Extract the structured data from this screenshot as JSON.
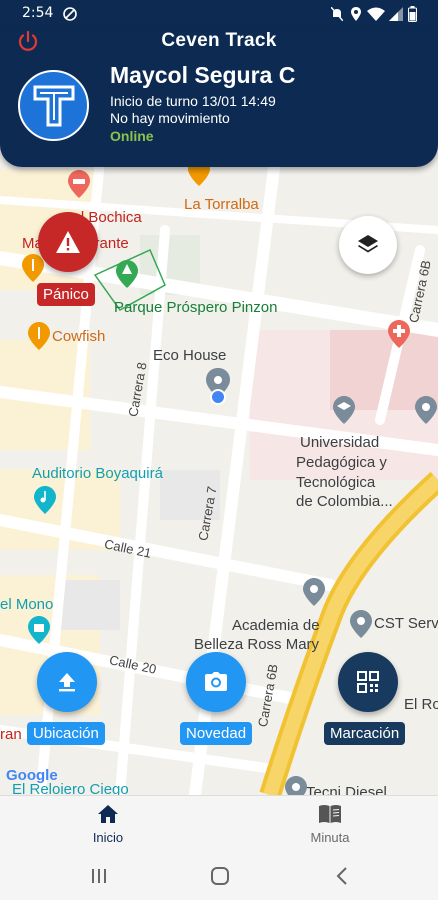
{
  "status_bar": {
    "time": "2:54"
  },
  "header": {
    "title": "Ceven Track",
    "user_name": "Maycol Segura C",
    "shift": "Inicio de turno 13/01 14:49",
    "movement": "No hay movimiento",
    "connection": "Online"
  },
  "map": {
    "places": {
      "hotel": "otel Bochica",
      "restaurant": "Ma    Restaurante",
      "torralba": "La Torralba",
      "park": "Parque Próspero Pinzon",
      "cowfish": "Cowfish",
      "eco_house": "Eco House",
      "university_1": "Universidad",
      "university_2": "Pedagógica y",
      "university_3": "Tecnológica",
      "university_4": "de Colombia...",
      "auditorio": "Auditorio Boyaquirá",
      "mono": "el Mono",
      "academia_1": "Academia de",
      "academia_2": "Belleza Ross Mary",
      "cst": "CST Serv",
      "el_ro": "El Ro",
      "tecni": "Tecni Diesel",
      "reloiero": "El Reloiero Ciego",
      "rang": "ran"
    },
    "streets": {
      "carrera_8": "Carrera 8",
      "carrera_7": "Carrera 7",
      "carrera_6b_top": "Carrera 6B",
      "carrera_6b_bottom": "Carrera 6B",
      "calle_21": "Calle 21",
      "calle_20": "Calle 20"
    },
    "attribution": "Google"
  },
  "actions": {
    "panic": "Pánico",
    "location": "Ubicación",
    "news": "Novedad",
    "mark": "Marcación"
  },
  "nav": {
    "home": "Inicio",
    "minute": "Minuta"
  },
  "colors": {
    "header_bg": "#0d2b52",
    "logo_bg": "#1e73d8",
    "online": "#8bc34a",
    "panic": "#c62828",
    "action_blue": "#2196f3",
    "mark_dark": "#173a5e"
  }
}
